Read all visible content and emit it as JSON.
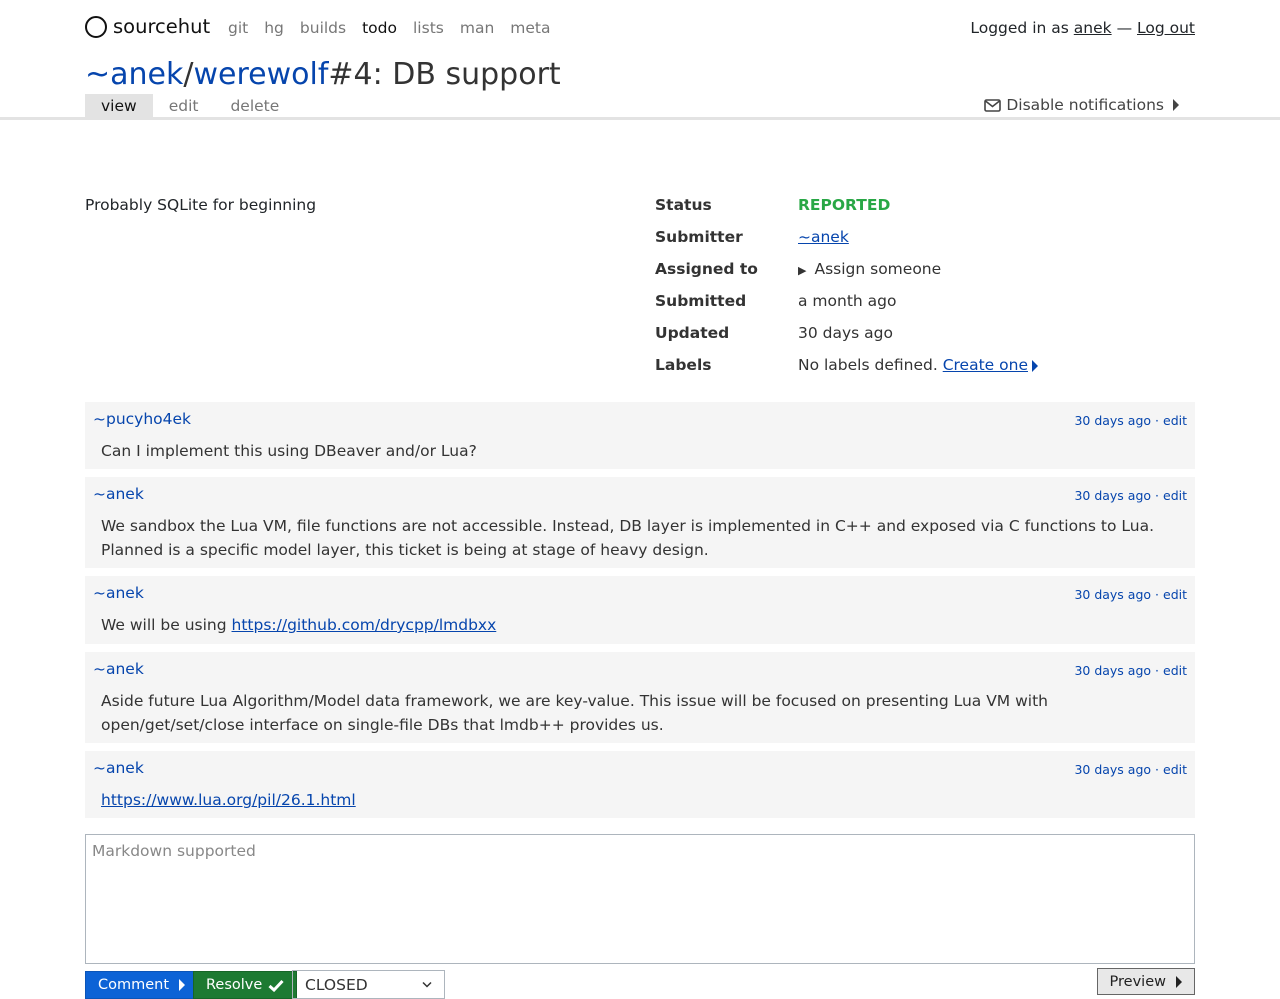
{
  "brand": {
    "name": "sourcehut"
  },
  "nav": {
    "items": [
      "git",
      "hg",
      "builds",
      "todo",
      "lists",
      "man",
      "meta"
    ],
    "active": "todo"
  },
  "auth": {
    "prefix": "Logged in as",
    "user": "anek",
    "separator": "—",
    "logout": "Log out"
  },
  "ticket": {
    "owner": "~anek",
    "slash": "/",
    "tracker": "werewolf",
    "title_rest": "#4: DB support",
    "description": "Probably SQLite for beginning"
  },
  "tabs": [
    "view",
    "edit",
    "delete"
  ],
  "notifications": {
    "label": "Disable notifications"
  },
  "details": {
    "status_label": "Status",
    "status_value": "REPORTED",
    "submitter_label": "Submitter",
    "submitter_value": "~anek",
    "assigned_label": "Assigned to",
    "assigned_value": "Assign someone",
    "submitted_label": "Submitted",
    "submitted_value": "a month ago",
    "updated_label": "Updated",
    "updated_value": "30 days ago",
    "labels_label": "Labels",
    "labels_value": "No labels defined.",
    "labels_link": "Create one"
  },
  "comments": [
    {
      "author": "~pucyho4ek",
      "time": "30 days ago",
      "sep": "·",
      "edit": "edit",
      "text": "Can I implement this using DBeaver and/or Lua?"
    },
    {
      "author": "~anek",
      "time": "30 days ago",
      "sep": "·",
      "edit": "edit",
      "text": "We sandbox the Lua VM, file functions are not accessible. Instead, DB layer is implemented in C++ and exposed via C functions to Lua. Planned is a specific model layer, this ticket is being at stage of heavy design."
    },
    {
      "author": "~anek",
      "time": "30 days ago",
      "sep": "·",
      "edit": "edit",
      "text_prefix": "We will be using",
      "link": "https://github.com/drycpp/lmdbxx"
    },
    {
      "author": "~anek",
      "time": "30 days ago",
      "sep": "·",
      "edit": "edit",
      "text": "Aside future Lua Algorithm/Model data framework, we are key-value. This issue will be focused on presenting Lua VM with open/get/set/close interface on single-file DBs that lmdb++ provides us."
    },
    {
      "author": "~anek",
      "time": "30 days ago",
      "sep": "·",
      "edit": "edit",
      "link": "https://www.lua.org/pil/26.1.html"
    }
  ],
  "form": {
    "placeholder": "Markdown supported",
    "comment_button": "Comment",
    "resolve_button": "Resolve",
    "resolution_value": "CLOSED",
    "preview_button": "Preview"
  },
  "colors": {
    "link": "#0645ad",
    "status": "#28a745",
    "comment_btn": "#0d63d6",
    "resolve_btn": "#1d7a32"
  },
  "icons": [
    "envelope-icon",
    "caret-right-icon",
    "check-icon",
    "chevron-down-icon",
    "disclosure-triangle-icon"
  ]
}
